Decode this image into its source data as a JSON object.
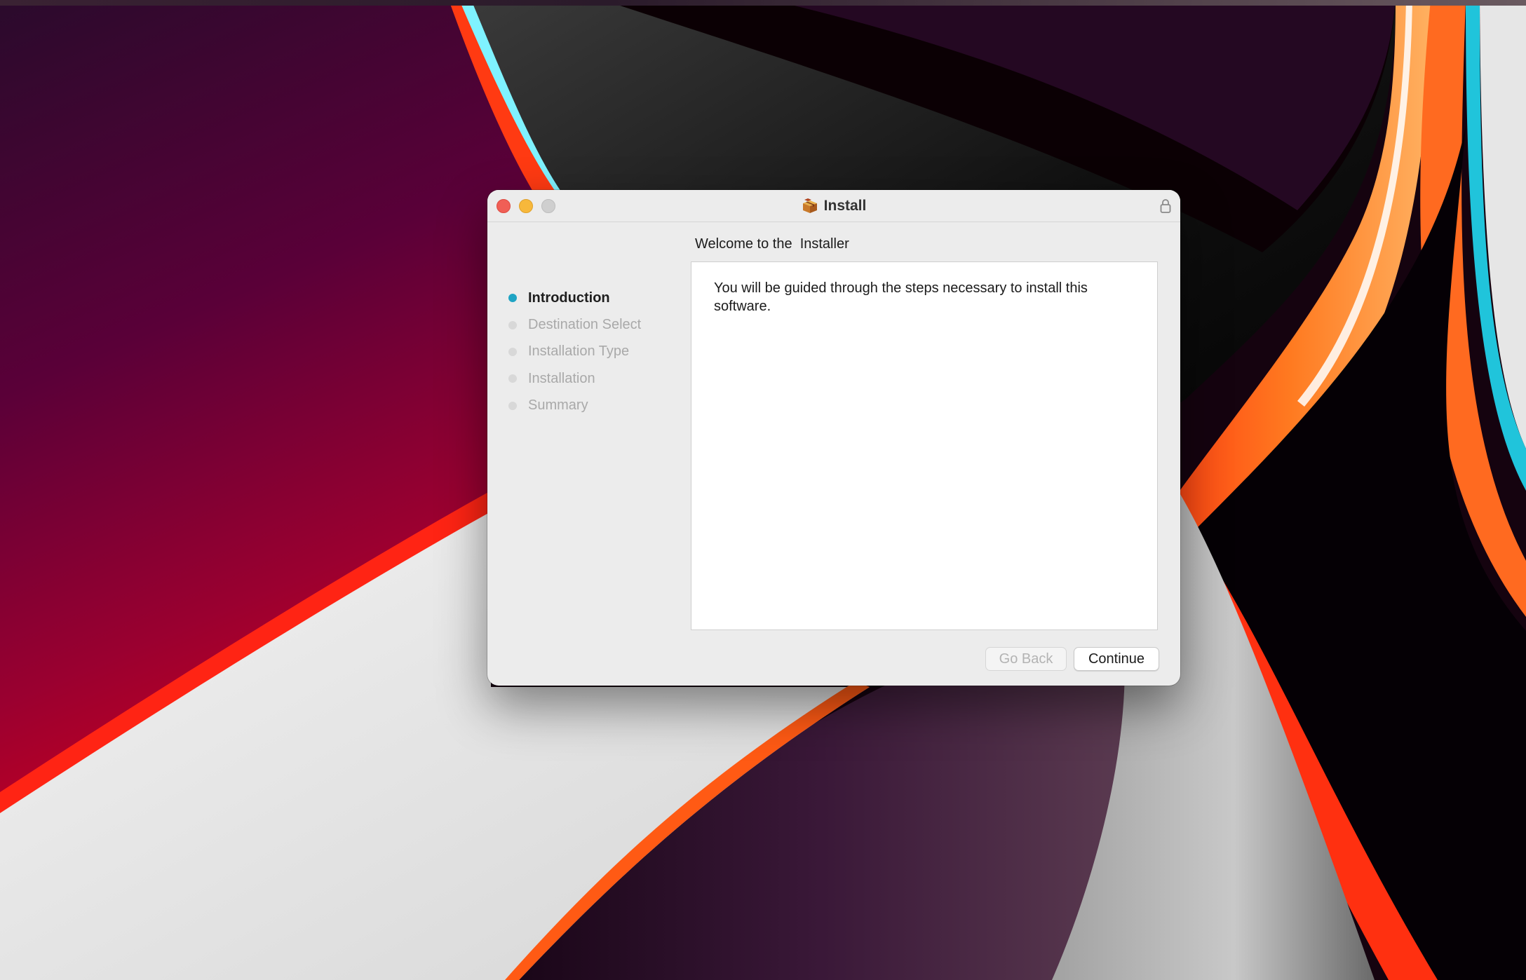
{
  "window": {
    "title": "Install",
    "title_icon": "package-icon",
    "lock_icon": "lock-icon"
  },
  "steps": [
    {
      "label": "Introduction",
      "state": "active"
    },
    {
      "label": "Destination Select",
      "state": "inactive"
    },
    {
      "label": "Installation Type",
      "state": "inactive"
    },
    {
      "label": "Installation",
      "state": "inactive"
    },
    {
      "label": "Summary",
      "state": "inactive"
    }
  ],
  "content": {
    "heading": "Welcome to the  Installer",
    "body": "You will be guided through the steps necessary to install this software."
  },
  "buttons": {
    "go_back": "Go Back",
    "continue": "Continue"
  },
  "colors": {
    "active_step": "#1fa4c4",
    "close": "#f05f56",
    "minimize": "#f7b83b",
    "zoom_disabled": "#cfcfcf"
  }
}
